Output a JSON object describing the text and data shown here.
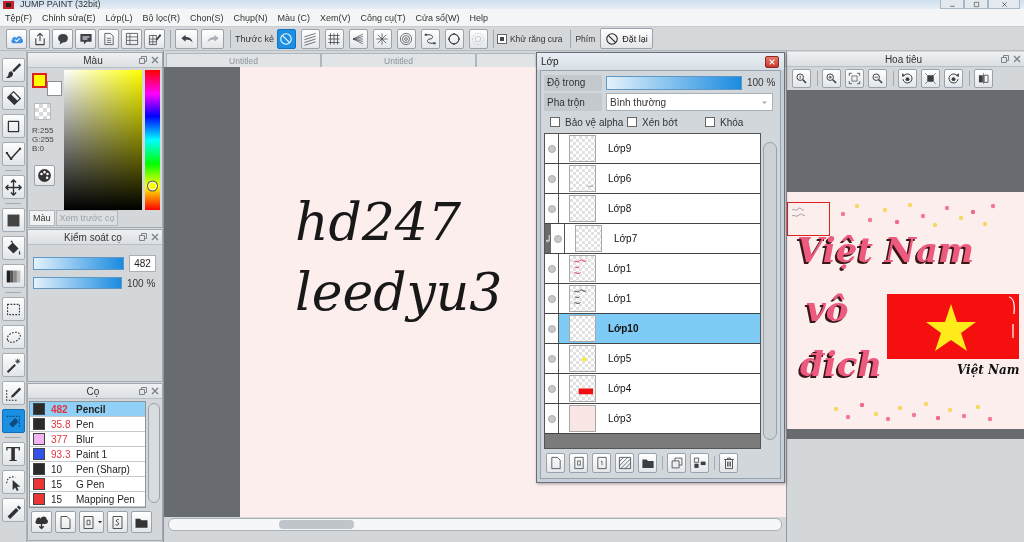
{
  "window": {
    "title": "JUMP PAINT (32bit)"
  },
  "menu": [
    "Tệp(F)",
    "Chỉnh sửa(E)",
    "Lớp(L)",
    "Bộ lọc(R)",
    "Chọn(S)",
    "Chụp(N)",
    "Màu (C)",
    "Xem(V)",
    "Công cụ(T)",
    "Cửa sổ(W)",
    "Help"
  ],
  "toolbar": {
    "history": [
      {
        "kind": "undo",
        "disabled": false
      },
      {
        "kind": "redo",
        "disabled": true
      }
    ],
    "ruler_label": "Thước kẻ",
    "rulers": [
      {
        "kind": "no-entry",
        "selected": true,
        "disabled": false
      },
      {
        "kind": "parallel-lines",
        "selected": false,
        "disabled": false
      },
      {
        "kind": "grid",
        "selected": false,
        "disabled": false
      },
      {
        "kind": "converging-lines",
        "selected": false,
        "disabled": false
      },
      {
        "kind": "burst",
        "selected": false,
        "disabled": false
      },
      {
        "kind": "concentric-circles",
        "selected": false,
        "disabled": false
      },
      {
        "kind": "curve",
        "selected": false,
        "disabled": false
      },
      {
        "kind": "circle",
        "selected": false,
        "disabled": false
      },
      {
        "kind": "dashed-circle",
        "selected": false,
        "disabled": true
      }
    ],
    "antialias": {
      "label": "Khử răng cưa",
      "checked": true
    },
    "keys_label": "Phím",
    "reset_button": "Đặt lại"
  },
  "tool_groups": [
    [
      {
        "kind": "brush",
        "selected": false
      },
      {
        "kind": "eraser",
        "selected": false
      },
      {
        "kind": "square",
        "selected": false
      },
      {
        "kind": "polyline",
        "selected": false
      }
    ],
    [
      {
        "kind": "move",
        "selected": false
      }
    ],
    [
      {
        "kind": "filled-square",
        "selected": false
      },
      {
        "kind": "bucket",
        "selected": false
      },
      {
        "kind": "gradient",
        "selected": false
      }
    ],
    [
      {
        "kind": "dashed-rectangle",
        "selected": false
      },
      {
        "kind": "lasso",
        "selected": false
      },
      {
        "kind": "magic-wand",
        "selected": false
      },
      {
        "kind": "dashed-pen",
        "selected": false
      },
      {
        "kind": "dashed-eraser",
        "selected": true
      }
    ],
    [
      {
        "kind": "text",
        "glyph": "T",
        "selected": false
      },
      {
        "kind": "cursor",
        "selected": false
      },
      {
        "kind": "pen",
        "selected": false
      }
    ]
  ],
  "color_panel": {
    "title": "Màu",
    "swatches": [
      {
        "color": "#ffff00",
        "selected": true
      },
      {
        "color": "#ffffff",
        "selected": false
      }
    ],
    "rgb": [
      "R:255",
      "G:255",
      "B:0"
    ],
    "hue": {
      "level": 0.17
    },
    "tabs": [
      {
        "label": "Màu",
        "selected": true
      },
      {
        "label": "Xem trước cọ",
        "selected": false
      }
    ]
  },
  "brush_control": {
    "title": "Kiểm soát cọ",
    "size": {
      "level": 1,
      "value": "482"
    },
    "opacity": {
      "level": 1,
      "reading": "100 %"
    }
  },
  "brush_list": {
    "title": "Cọ",
    "items": [
      {
        "color": "#2b2b2b",
        "size": "482",
        "name": "Pencil",
        "marked": true,
        "selected": true
      },
      {
        "color": "#2b2b2b",
        "size": "35.8",
        "name": "Pen",
        "marked": true,
        "selected": false
      },
      {
        "color": "#f2b4f2",
        "size": "377",
        "name": "Blur",
        "marked": true,
        "selected": false
      },
      {
        "color": "#3552e8",
        "size": "93.3",
        "name": "Paint 1",
        "marked": true,
        "selected": false
      },
      {
        "color": "#2b2b2b",
        "size": "10",
        "name": "Pen (Sharp)",
        "marked": false,
        "selected": false
      },
      {
        "color": "#ec3535",
        "size": "15",
        "name": "G Pen",
        "marked": false,
        "selected": false
      },
      {
        "color": "#ec3535",
        "size": "15",
        "name": "Mapping Pen",
        "marked": false,
        "selected": false
      }
    ]
  },
  "documents": {
    "tabs": [
      "Untitled",
      "Untitled"
    ]
  },
  "canvas": {
    "handwriting": [
      "hd247",
      "leedyu3"
    ]
  },
  "layers_panel": {
    "title": "Lớp",
    "opacity": {
      "label": "Độ trong",
      "level": 1,
      "reading": "100 %"
    },
    "blend": {
      "label": "Pha trộn",
      "value": "Bình thường"
    },
    "options": [
      {
        "label": "Bảo vệ alpha",
        "checked": false
      },
      {
        "label": "Xén bớt",
        "checked": false
      },
      {
        "label": "Khóa",
        "checked": false
      }
    ],
    "layers": [
      {
        "name": "Lớp9",
        "kind": "empty",
        "clipped": false,
        "selected": false
      },
      {
        "name": "Lớp6",
        "kind": "corner-mark",
        "clipped": false,
        "selected": false
      },
      {
        "name": "Lớp8",
        "kind": "empty",
        "clipped": false,
        "selected": false
      },
      {
        "name": "Lớp7",
        "kind": "empty",
        "clipped": true,
        "selected": false
      },
      {
        "name": "Lớp1",
        "kind": "red-text",
        "clipped": false,
        "selected": false
      },
      {
        "name": "Lớp1",
        "kind": "dark-text",
        "clipped": false,
        "selected": false
      },
      {
        "name": "Lớp10",
        "kind": "empty",
        "clipped": false,
        "selected": true
      },
      {
        "name": "Lớp5",
        "kind": "yellow-dot",
        "clipped": false,
        "selected": false
      },
      {
        "name": "Lớp4",
        "kind": "red-bar",
        "clipped": false,
        "selected": false
      },
      {
        "name": "Lớp3",
        "kind": "pink",
        "clipped": false,
        "selected": false
      }
    ]
  },
  "navigator": {
    "title": "Hoa tiêu",
    "preview": {
      "lettering": [
        "Việt Nam",
        "vô",
        "đich"
      ],
      "caption": "Việt Nam"
    }
  }
}
